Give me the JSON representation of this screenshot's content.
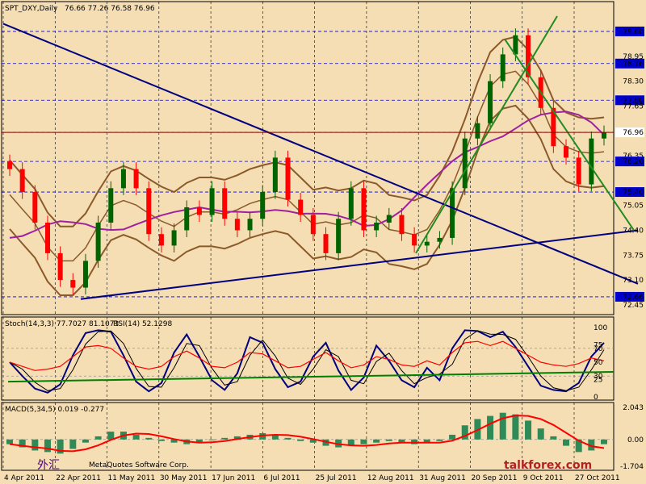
{
  "window": {
    "symbol_label": "SPT_DXY,Daily",
    "ohlc_label": "76.66 77.26 76.58 76.96",
    "watermark_cn": "外汇",
    "watermark_site": "talkforex.com",
    "copyright": "MetaQuotes Software Corp."
  },
  "main_price_axis": {
    "ticks": [
      "79.60",
      "78.95",
      "78.76",
      "78.30",
      "77.80",
      "77.65",
      "76.96",
      "76.35",
      "76.20",
      "75.40",
      "75.05",
      "74.40",
      "73.75",
      "73.10",
      "72.66",
      "72.45"
    ],
    "highlighted": [
      "79.60",
      "78.76",
      "77.80",
      "76.96",
      "76.20",
      "75.40",
      "72.66"
    ]
  },
  "x_axis": {
    "dates": [
      "4 Apr 2011",
      "22 Apr 2011",
      "11 May 2011",
      "30 May 2011",
      "17 Jun 2011",
      "6 Jul 2011",
      "25 Jul 2011",
      "12 Aug 2011",
      "31 Aug 2011",
      "20 Sep 2011",
      "9 Oct 2011",
      "27 Oct 2011"
    ]
  },
  "stochastic_panel": {
    "label": "Stoch(14,3,3) 77.7027 81.1073",
    "rsi_label": "RSI(14) 52.1298",
    "ticks": [
      "100",
      "75",
      "70",
      "50",
      "30",
      "25",
      "0"
    ]
  },
  "macd_panel": {
    "label": "MACD(5,34,5) 0.019 -0.277",
    "ticks": [
      "2.043",
      "0.00",
      "-1.704"
    ]
  },
  "colors": {
    "background": "#F5DEB3",
    "bull_candle": "#006400",
    "bear_candle": "#FF0000",
    "bollinger": "#8B5A2B",
    "trendline": "#000080",
    "channel": "#228B22",
    "ma_magenta": "#A020A0",
    "price_line": "#8B0000"
  },
  "chart_data": [
    {
      "type": "candlestick",
      "title": "SPT_DXY,Daily",
      "current": {
        "open": 76.66,
        "high": 77.26,
        "low": 76.58,
        "close": 76.96
      },
      "ylim": [
        72.3,
        80.0
      ],
      "x": [
        "4 Apr 2011",
        "22 Apr 2011",
        "11 May 2011",
        "30 May 2011",
        "17 Jun 2011",
        "6 Jul 2011",
        "25 Jul 2011",
        "12 Aug 2011",
        "31 Aug 2011",
        "20 Sep 2011",
        "9 Oct 2011",
        "27 Oct 2011"
      ],
      "close_series": [
        76.0,
        75.4,
        74.6,
        73.8,
        73.1,
        72.9,
        73.6,
        74.6,
        75.5,
        76.0,
        75.5,
        74.3,
        74.0,
        74.4,
        75.0,
        74.8,
        75.5,
        74.7,
        74.4,
        74.7,
        75.4,
        76.3,
        75.2,
        74.8,
        74.3,
        73.8,
        74.7,
        75.5,
        74.4,
        74.6,
        74.8,
        74.3,
        74.0,
        74.1,
        74.2,
        75.5,
        76.8,
        77.2,
        78.3,
        79.0,
        79.5,
        78.4,
        77.6,
        76.6,
        76.3,
        75.6,
        76.8,
        76.96
      ]
    },
    {
      "type": "line",
      "title": "Stoch(14,3,3) 77.7027 81.1073",
      "ylim": [
        0,
        100
      ],
      "series": [
        {
          "name": "Stoch(14,3,3)",
          "values": [
            50,
            30,
            12,
            6,
            18,
            60,
            92,
            96,
            94,
            60,
            22,
            8,
            20,
            64,
            90,
            58,
            24,
            10,
            34,
            86,
            78,
            40,
            14,
            22,
            58,
            78,
            38,
            10,
            28,
            74,
            52,
            24,
            14,
            42,
            24,
            70,
            96,
            95,
            86,
            94,
            72,
            44,
            16,
            10,
            8,
            20,
            58,
            78
          ]
        },
        {
          "name": "RSI(14)",
          "values": [
            50,
            44,
            38,
            40,
            44,
            58,
            72,
            74,
            70,
            56,
            44,
            40,
            44,
            58,
            66,
            56,
            44,
            42,
            50,
            64,
            62,
            52,
            42,
            44,
            54,
            64,
            52,
            42,
            46,
            58,
            54,
            46,
            44,
            52,
            46,
            64,
            78,
            80,
            74,
            80,
            70,
            60,
            50,
            46,
            44,
            48,
            56,
            52
          ]
        }
      ]
    },
    {
      "type": "bar",
      "title": "MACD(5,34,5) 0.019 -0.277",
      "ylim": [
        -1.704,
        2.043
      ],
      "values": [
        -0.3,
        -0.5,
        -0.7,
        -0.8,
        -0.9,
        -0.6,
        -0.2,
        0.2,
        0.5,
        0.5,
        0.3,
        0.1,
        -0.1,
        -0.2,
        -0.3,
        -0.2,
        0.0,
        0.1,
        0.2,
        0.3,
        0.4,
        0.3,
        0.1,
        -0.1,
        -0.2,
        -0.4,
        -0.5,
        -0.4,
        -0.3,
        -0.2,
        -0.1,
        -0.2,
        -0.3,
        -0.2,
        -0.1,
        0.3,
        0.9,
        1.3,
        1.5,
        1.7,
        1.6,
        1.2,
        0.7,
        0.2,
        -0.4,
        -0.8,
        -0.7,
        -0.3
      ]
    }
  ]
}
